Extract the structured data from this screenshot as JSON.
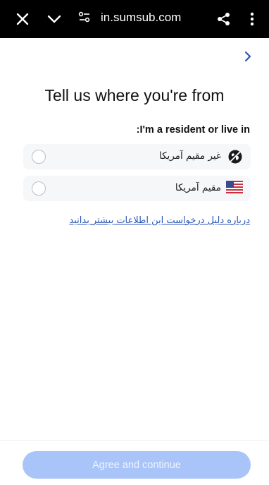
{
  "browser": {
    "url": "in.sumsub.com",
    "icons": [
      "close-icon",
      "chevron-down-icon",
      "site-settings-icon",
      "share-icon",
      "more-vert-icon"
    ]
  },
  "page": {
    "nav_icon": "chevron-right-icon",
    "title": "Tell us where you're from",
    "subtitle": ":I'm a resident or live in",
    "options": [
      {
        "label": "غیر مقیم آمریکا",
        "icon": "globe-icon",
        "selected": false
      },
      {
        "label": "مقیم آمریکا",
        "icon": "us-flag-icon",
        "selected": false
      }
    ],
    "info_link": "درباره دلیل درخواست این اطلاعات بیشتر بدانید",
    "agree_button": "Agree and continue"
  },
  "colors": {
    "topbar": "#000000",
    "link": "#2b56b3",
    "button_disabled": "#a9c4f9"
  }
}
